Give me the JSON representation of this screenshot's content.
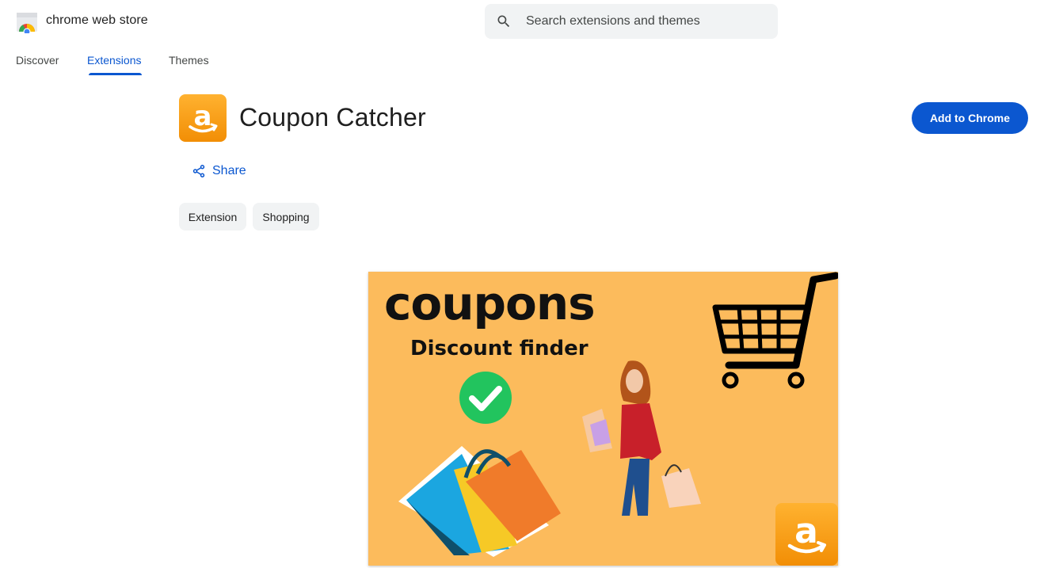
{
  "header": {
    "store_name": "chrome web store",
    "search_placeholder": "Search extensions and themes"
  },
  "nav": {
    "tabs": [
      {
        "label": "Discover",
        "active": false
      },
      {
        "label": "Extensions",
        "active": true
      },
      {
        "label": "Themes",
        "active": false
      }
    ]
  },
  "extension": {
    "name": "Coupon Catcher",
    "add_button": "Add to Chrome",
    "share_label": "Share",
    "chips": [
      "Extension",
      "Shopping"
    ]
  },
  "hero": {
    "headline": "coupons",
    "subheadline": "Discount finder"
  },
  "colors": {
    "accent": "#0b57d0",
    "hero_bg": "#fcbb5c",
    "icon_orange": "#f7a21a",
    "check_green": "#22c45e"
  },
  "icons": [
    "search-icon",
    "share-icon",
    "amazon-logo-icon",
    "checkmark-icon",
    "shopping-cart-icon"
  ]
}
